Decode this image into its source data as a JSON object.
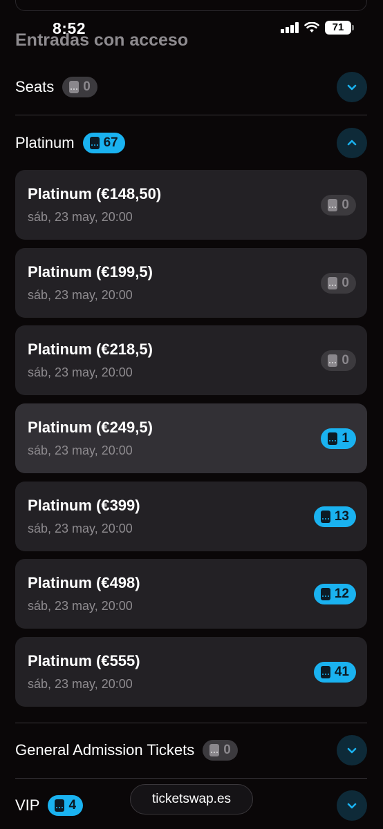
{
  "status_bar": {
    "time": "8:52",
    "battery": "71"
  },
  "section": {
    "title": "Entradas con acceso"
  },
  "categories": [
    {
      "name": "Seats",
      "count": "0"
    },
    {
      "name": "Platinum",
      "count": "67"
    },
    {
      "name": "General Admission Tickets",
      "count": "0"
    },
    {
      "name": "VIP",
      "count": "4"
    }
  ],
  "tickets": [
    {
      "title": "Platinum (€148,50)",
      "date": "sáb, 23 may, 20:00",
      "count": "0"
    },
    {
      "title": "Platinum (€199,5)",
      "date": "sáb, 23 may, 20:00",
      "count": "0"
    },
    {
      "title": "Platinum (€218,5)",
      "date": "sáb, 23 may, 20:00",
      "count": "0"
    },
    {
      "title": "Platinum (€249,5)",
      "date": "sáb, 23 may, 20:00",
      "count": "1"
    },
    {
      "title": "Platinum (€399)",
      "date": "sáb, 23 may, 20:00",
      "count": "13"
    },
    {
      "title": "Platinum (€498)",
      "date": "sáb, 23 may, 20:00",
      "count": "12"
    },
    {
      "title": "Platinum (€555)",
      "date": "sáb, 23 may, 20:00",
      "count": "41"
    }
  ],
  "footer": {
    "domain": "ticketswap.es"
  },
  "colors": {
    "accent": "#1ab2f0",
    "background": "#0a0708",
    "card": "#232125",
    "muted": "#8e8b8f"
  },
  "icons": [
    "ticket-icon",
    "chevron-down-icon",
    "chevron-up-icon",
    "signal-icon",
    "wifi-icon",
    "battery-icon"
  ]
}
